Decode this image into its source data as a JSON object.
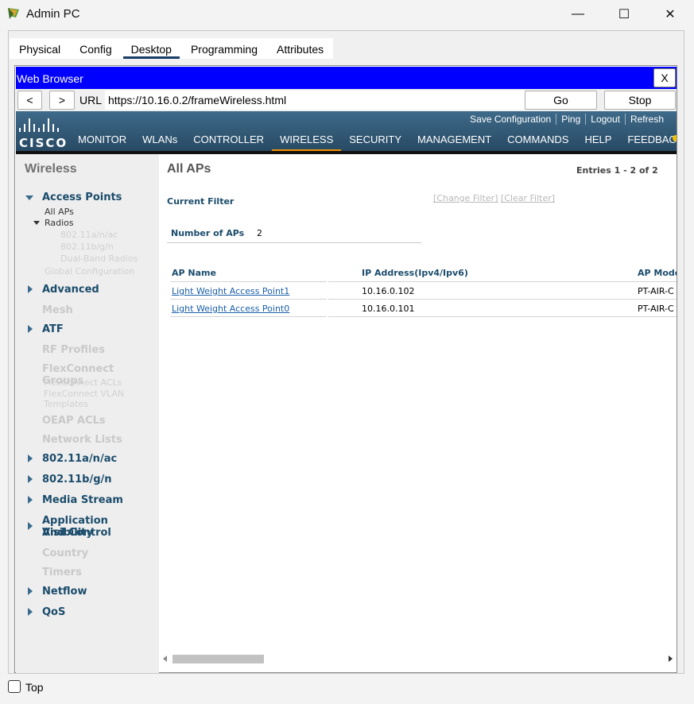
{
  "window": {
    "title": "Admin PC",
    "controls": {
      "minimize": "—",
      "maximize": "☐",
      "close": "✕"
    }
  },
  "tabs": [
    {
      "label": "Physical"
    },
    {
      "label": "Config"
    },
    {
      "label": "Desktop",
      "active": true
    },
    {
      "label": "Programming"
    },
    {
      "label": "Attributes"
    }
  ],
  "browser": {
    "title": "Web Browser",
    "close_label": "X",
    "back_label": "<",
    "forward_label": ">",
    "url_label": "URL",
    "url": "https://10.16.0.2/frameWireless.html",
    "go_label": "Go",
    "stop_label": "Stop"
  },
  "cisco": {
    "logo_text": "CISCO",
    "util_links": [
      "Save Configuration",
      "Ping",
      "Logout",
      "Refresh"
    ],
    "menu": [
      {
        "label": "MONITOR"
      },
      {
        "label": "WLANs"
      },
      {
        "label": "CONTROLLER"
      },
      {
        "label": "WIRELESS",
        "active": true
      },
      {
        "label": "SECURITY"
      },
      {
        "label": "MANAGEMENT"
      },
      {
        "label": "COMMANDS"
      },
      {
        "label": "HELP"
      },
      {
        "label": "FEEDBACK"
      }
    ],
    "brand_colors": {
      "header": "#325a77",
      "accent": "#f29000"
    }
  },
  "sidebar": {
    "title": "Wireless",
    "access_points": "Access Points",
    "all_aps": "All APs",
    "radios": "Radios",
    "radio_80211anac": "802.11a/n/ac",
    "radio_80211bgn": "802.11b/g/n",
    "radio_dual_band": "Dual-Band Radios",
    "global_configuration": "Global Configuration",
    "advanced": "Advanced",
    "mesh": "Mesh",
    "atf": "ATF",
    "rf_profiles": "RF Profiles",
    "flexconnect_groups": "FlexConnect Groups",
    "flexconnect_acls": "FlexConnect ACLs",
    "flexconnect_vlan": "FlexConnect VLAN",
    "templates": "Templates",
    "oeap_acls": "OEAP ACLs",
    "network_lists": "Network Lists",
    "band_anac": "802.11a/n/ac",
    "band_bgn": "802.11b/g/n",
    "media_stream": "Media Stream",
    "app_visibility_1": "Application Visibility",
    "app_visibility_2": "And Control",
    "country": "Country",
    "timers": "Timers",
    "netflow": "Netflow",
    "qos": "QoS"
  },
  "main": {
    "title": "All APs",
    "entries": "Entries 1 - 2 of 2",
    "current_filter": "Current Filter",
    "change_filter": "[Change Filter]",
    "clear_filter": "[Clear Filter]",
    "number_of_aps_label": "Number of APs",
    "number_of_aps_value": "2",
    "columns": [
      "AP Name",
      "IP Address(Ipv4/Ipv6)",
      "AP Mode"
    ],
    "rows": [
      {
        "name": "Light Weight Access Point1",
        "ip": "10.16.0.102",
        "model": "PT-AIR-C"
      },
      {
        "name": "Light Weight Access Point0",
        "ip": "10.16.0.101",
        "model": "PT-AIR-C"
      }
    ]
  },
  "footer": {
    "top_label": "Top"
  }
}
